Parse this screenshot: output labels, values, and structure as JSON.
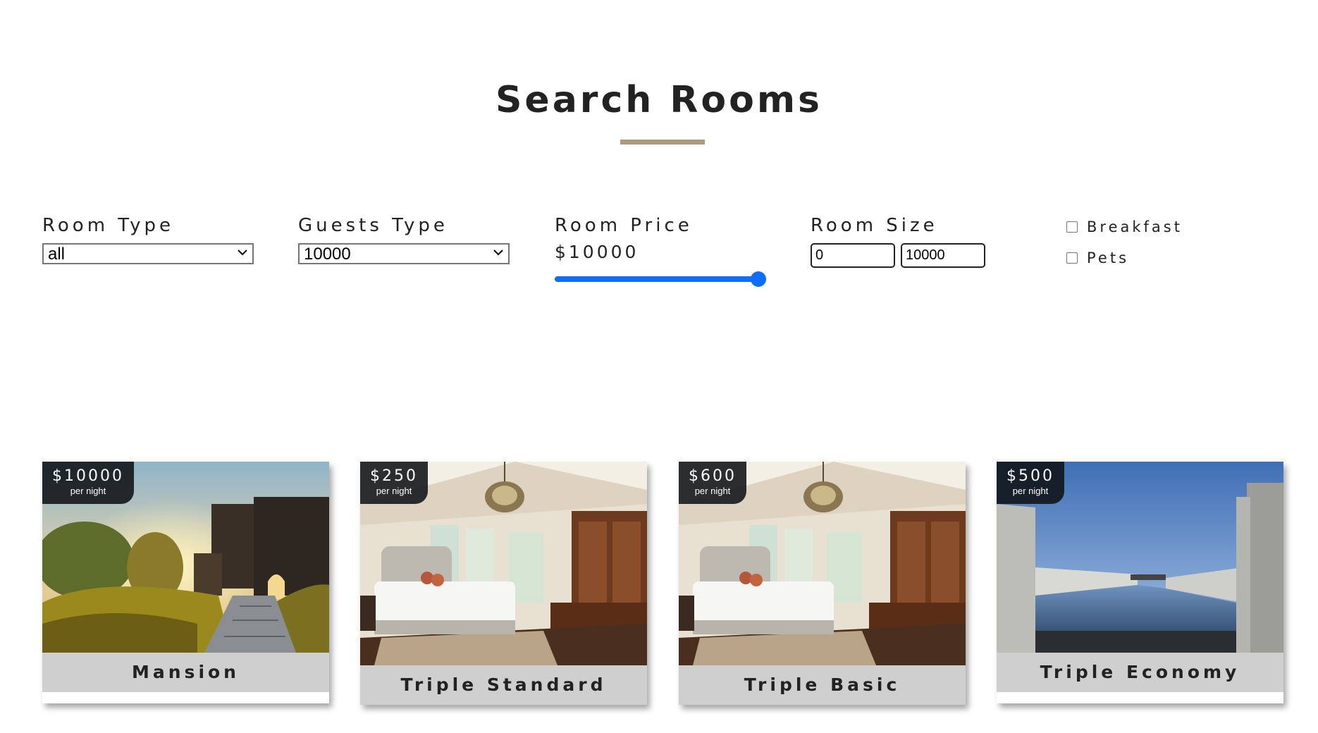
{
  "page": {
    "title": "Search Rooms",
    "accent_color": "#af9a7d"
  },
  "filters": {
    "room_type": {
      "label": "Room Type",
      "selected": "all"
    },
    "guests_type": {
      "label": "Guests Type",
      "selected": "10000"
    },
    "room_price": {
      "label": "Room Price",
      "value_text": "$10000",
      "slider_fraction": 1.0,
      "slider_color": "#0d6efd"
    },
    "room_size": {
      "label": "Room Size",
      "min_value": "0",
      "max_value": "10000"
    },
    "checkboxes": [
      {
        "label": "Breakfast",
        "checked": false
      },
      {
        "label": "Pets",
        "checked": false
      }
    ]
  },
  "rooms": [
    {
      "name": "Mansion",
      "price": "$10000",
      "per_night": "per night",
      "image": "castle-path-photo"
    },
    {
      "name": "Triple Standard",
      "price": "$250",
      "per_night": "per night",
      "image": "bedroom-chandelier-photo"
    },
    {
      "name": "Triple Basic",
      "price": "$600",
      "per_night": "per night",
      "image": "bedroom-chandelier-photo"
    },
    {
      "name": "Triple Economy",
      "price": "$500",
      "per_night": "per night",
      "image": "reflecting-pool-photo"
    }
  ]
}
